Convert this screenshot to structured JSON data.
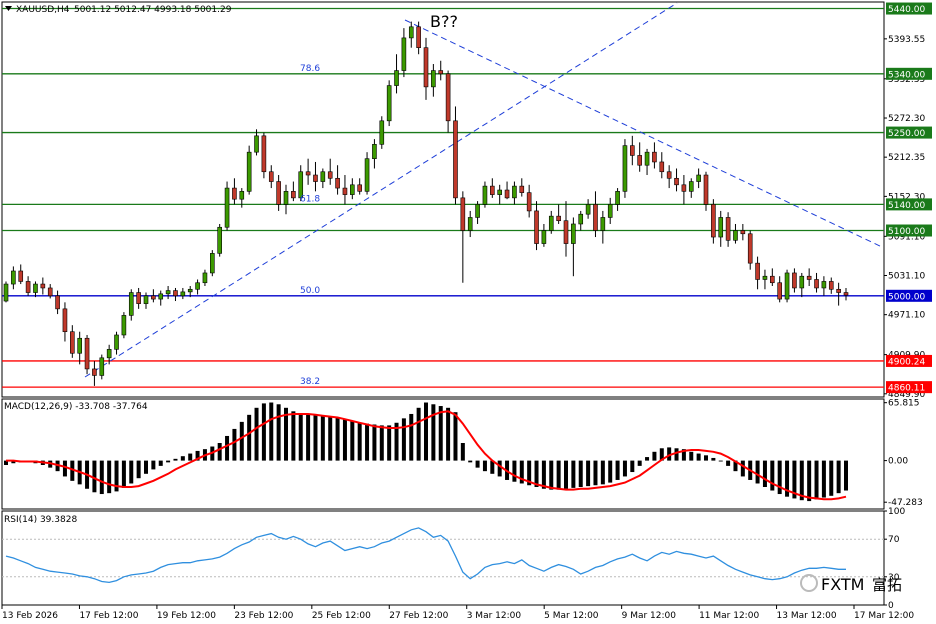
{
  "header": {
    "symbol": "XAUUSD,H4",
    "ohlc": "5001.12 5012.47 4993.18 5001.29"
  },
  "wave_label": "B??",
  "watermark": {
    "logo": "FXTM",
    "text": "富拓"
  },
  "colors": {
    "bull": "#3c9a00",
    "bear": "#c0392b",
    "green_level": "#1a7a1a",
    "red_level": "#ff0000",
    "blue_level": "#0000cc",
    "trend": "#1f3fd8",
    "macd_signal": "#ff0000",
    "rsi": "#2f8fdf"
  },
  "chart_data": [
    {
      "type": "candlestick",
      "title": "XAUUSD,H4",
      "ylim": [
        4845,
        5450
      ],
      "price_ticks": [
        "5393.55",
        "5332.35",
        "5272.30",
        "5212.35",
        "5152.30",
        "5091.10",
        "5031.10",
        "4971.10",
        "4909.90",
        "4849.90"
      ],
      "horizontal_levels": [
        {
          "value": 5440.0,
          "label": "5440.00",
          "color": "green"
        },
        {
          "value": 5340.0,
          "label": "5340.00",
          "color": "green"
        },
        {
          "value": 5250.0,
          "label": "5250.00",
          "color": "green"
        },
        {
          "value": 5140.0,
          "label": "5140.00",
          "color": "green"
        },
        {
          "value": 5100.0,
          "label": "5100.00",
          "color": "green"
        },
        {
          "value": 5000.0,
          "label": "5000.00",
          "color": "blue"
        },
        {
          "value": 4900.24,
          "label": "4900.24",
          "color": "red"
        },
        {
          "value": 4860.11,
          "label": "4860.11",
          "color": "red"
        }
      ],
      "fibonacci_labels": [
        {
          "text": "78.6",
          "value": 5340.0
        },
        {
          "text": "61.8",
          "value": 5140.0
        },
        {
          "text": "50.0",
          "value": 5000.0
        },
        {
          "text": "38.2",
          "value": 4860.11
        }
      ],
      "x_labels": [
        "13 Feb 2026",
        "17 Feb 12:00",
        "19 Feb 12:00",
        "23 Feb 12:00",
        "25 Feb 12:00",
        "27 Feb 12:00",
        "3 Mar 12:00",
        "5 Mar 12:00",
        "9 Mar 12:00",
        "11 Mar 12:00",
        "13 Mar 12:00",
        "17 Mar 12:00"
      ],
      "candles": [
        [
          4992,
          5022,
          4990,
          5018
        ],
        [
          5018,
          5045,
          5010,
          5038
        ],
        [
          5038,
          5048,
          5018,
          5022
        ],
        [
          5022,
          5030,
          5000,
          5005
        ],
        [
          5005,
          5022,
          4998,
          5018
        ],
        [
          5018,
          5028,
          5002,
          5012
        ],
        [
          5012,
          5018,
          4996,
          5000
        ],
        [
          5000,
          5008,
          4972,
          4980
        ],
        [
          4980,
          4990,
          4930,
          4945
        ],
        [
          4945,
          4955,
          4905,
          4912
        ],
        [
          4912,
          4945,
          4895,
          4935
        ],
        [
          4935,
          4940,
          4880,
          4888
        ],
        [
          4888,
          4900,
          4862,
          4878
        ],
        [
          4878,
          4910,
          4872,
          4905
        ],
        [
          4905,
          4925,
          4895,
          4918
        ],
        [
          4918,
          4945,
          4910,
          4940
        ],
        [
          4940,
          4975,
          4935,
          4970
        ],
        [
          4970,
          5010,
          4962,
          5005
        ],
        [
          5005,
          5012,
          4980,
          4988
        ],
        [
          4988,
          5005,
          4980,
          5000
        ],
        [
          5000,
          5010,
          4990,
          4995
        ],
        [
          4995,
          5008,
          4985,
          5003
        ],
        [
          5003,
          5015,
          4995,
          5008
        ],
        [
          5008,
          5012,
          4992,
          5000
        ],
        [
          5000,
          5012,
          4995,
          5006
        ],
        [
          5006,
          5015,
          4998,
          5010
        ],
        [
          5010,
          5025,
          5002,
          5020
        ],
        [
          5020,
          5040,
          5015,
          5035
        ],
        [
          5035,
          5070,
          5030,
          5065
        ],
        [
          5065,
          5110,
          5060,
          5105
        ],
        [
          5105,
          5175,
          5100,
          5165
        ],
        [
          5165,
          5180,
          5140,
          5148
        ],
        [
          5148,
          5165,
          5135,
          5160
        ],
        [
          5160,
          5230,
          5155,
          5220
        ],
        [
          5220,
          5255,
          5215,
          5245
        ],
        [
          5245,
          5250,
          5180,
          5190
        ],
        [
          5190,
          5200,
          5165,
          5175
        ],
        [
          5175,
          5185,
          5130,
          5140
        ],
        [
          5140,
          5170,
          5125,
          5160
        ],
        [
          5160,
          5175,
          5145,
          5150
        ],
        [
          5150,
          5200,
          5145,
          5190
        ],
        [
          5190,
          5210,
          5170,
          5185
        ],
        [
          5185,
          5205,
          5160,
          5175
        ],
        [
          5175,
          5195,
          5165,
          5190
        ],
        [
          5190,
          5210,
          5170,
          5180
        ],
        [
          5180,
          5200,
          5155,
          5165
        ],
        [
          5165,
          5185,
          5140,
          5155
        ],
        [
          5155,
          5180,
          5148,
          5170
        ],
        [
          5170,
          5180,
          5155,
          5160
        ],
        [
          5160,
          5220,
          5155,
          5210
        ],
        [
          5210,
          5240,
          5195,
          5232
        ],
        [
          5232,
          5275,
          5225,
          5268
        ],
        [
          5268,
          5330,
          5260,
          5322
        ],
        [
          5322,
          5370,
          5310,
          5345
        ],
        [
          5345,
          5410,
          5335,
          5395
        ],
        [
          5395,
          5420,
          5380,
          5412
        ],
        [
          5412,
          5420,
          5370,
          5380
        ],
        [
          5380,
          5395,
          5300,
          5320
        ],
        [
          5320,
          5355,
          5305,
          5345
        ],
        [
          5345,
          5360,
          5330,
          5340
        ],
        [
          5340,
          5345,
          5250,
          5268
        ],
        [
          5268,
          5290,
          5140,
          5150
        ],
        [
          5150,
          5160,
          5020,
          5100
        ],
        [
          5100,
          5130,
          5090,
          5120
        ],
        [
          5120,
          5145,
          5110,
          5140
        ],
        [
          5140,
          5175,
          5135,
          5168
        ],
        [
          5168,
          5180,
          5150,
          5155
        ],
        [
          5155,
          5170,
          5140,
          5162
        ],
        [
          5162,
          5175,
          5148,
          5150
        ],
        [
          5150,
          5175,
          5140,
          5168
        ],
        [
          5168,
          5180,
          5152,
          5158
        ],
        [
          5158,
          5170,
          5120,
          5130
        ],
        [
          5130,
          5145,
          5070,
          5080
        ],
        [
          5080,
          5110,
          5075,
          5100
        ],
        [
          5100,
          5130,
          5095,
          5122
        ],
        [
          5122,
          5140,
          5110,
          5115
        ],
        [
          5115,
          5145,
          5060,
          5080
        ],
        [
          5080,
          5120,
          5030,
          5110
        ],
        [
          5110,
          5130,
          5100,
          5125
        ],
        [
          5125,
          5148,
          5118,
          5140
        ],
        [
          5140,
          5160,
          5090,
          5100
        ],
        [
          5100,
          5130,
          5080,
          5120
        ],
        [
          5120,
          5150,
          5110,
          5140
        ],
        [
          5140,
          5165,
          5130,
          5160
        ],
        [
          5160,
          5240,
          5150,
          5230
        ],
        [
          5230,
          5245,
          5200,
          5215
        ],
        [
          5215,
          5235,
          5190,
          5200
        ],
        [
          5200,
          5225,
          5185,
          5220
        ],
        [
          5220,
          5235,
          5195,
          5205
        ],
        [
          5205,
          5220,
          5180,
          5190
        ],
        [
          5190,
          5200,
          5165,
          5180
        ],
        [
          5180,
          5195,
          5160,
          5170
        ],
        [
          5170,
          5185,
          5140,
          5160
        ],
        [
          5160,
          5180,
          5150,
          5175
        ],
        [
          5175,
          5195,
          5165,
          5185
        ],
        [
          5185,
          5190,
          5130,
          5140
        ],
        [
          5140,
          5148,
          5080,
          5090
        ],
        [
          5090,
          5130,
          5075,
          5120
        ],
        [
          5120,
          5128,
          5075,
          5085
        ],
        [
          5085,
          5110,
          5080,
          5100
        ],
        [
          5100,
          5110,
          5085,
          5095
        ],
        [
          5095,
          5100,
          5040,
          5050
        ],
        [
          5050,
          5060,
          5010,
          5025
        ],
        [
          5025,
          5040,
          5010,
          5030
        ],
        [
          5030,
          5042,
          5015,
          5020
        ],
        [
          5020,
          5030,
          4990,
          4995
        ],
        [
          4995,
          5040,
          4990,
          5035
        ],
        [
          5035,
          5042,
          5005,
          5012
        ],
        [
          5012,
          5035,
          4998,
          5030
        ],
        [
          5030,
          5042,
          5015,
          5025
        ],
        [
          5025,
          5035,
          5005,
          5012
        ],
        [
          5012,
          5030,
          5000,
          5022
        ],
        [
          5022,
          5028,
          5003,
          5010
        ],
        [
          5010,
          5020,
          4985,
          5005
        ],
        [
          5005,
          5012,
          4993,
          5001
        ]
      ]
    },
    {
      "type": "bar",
      "title": "MACD(12,26,9) -33.708 -37.764",
      "ylim": [
        -55,
        70
      ],
      "y_ticks": [
        "65.815",
        "0.00",
        "-47.283"
      ],
      "histogram": [
        -5,
        -3,
        -2,
        -2,
        -3,
        -5,
        -8,
        -12,
        -18,
        -23,
        -27,
        -32,
        -36,
        -38,
        -37,
        -35,
        -31,
        -26,
        -20,
        -15,
        -10,
        -6,
        -2,
        2,
        5,
        8,
        11,
        13,
        16,
        20,
        28,
        36,
        44,
        52,
        60,
        65,
        66,
        64,
        60,
        56,
        54,
        53,
        52,
        51,
        50,
        49,
        47,
        45,
        43,
        42,
        41,
        40,
        40,
        43,
        48,
        53,
        60,
        66,
        64,
        62,
        60,
        55,
        20,
        -2,
        -8,
        -12,
        -15,
        -18,
        -22,
        -24,
        -26,
        -28,
        -30,
        -32,
        -33,
        -33,
        -32,
        -31,
        -30,
        -29,
        -28,
        -27,
        -25,
        -22,
        -18,
        -13,
        -6,
        4,
        10,
        14,
        15,
        14,
        13,
        10,
        8,
        6,
        3,
        -1,
        -6,
        -12,
        -18,
        -22,
        -26,
        -30,
        -34,
        -38,
        -41,
        -43,
        -45,
        -46,
        -44,
        -42,
        -40,
        -37,
        -34
      ],
      "signal": [
        0,
        0,
        -1,
        -1,
        -1,
        -2,
        -3,
        -5,
        -7,
        -10,
        -13,
        -16,
        -20,
        -24,
        -27,
        -29,
        -30,
        -30,
        -29,
        -26,
        -23,
        -19,
        -15,
        -10,
        -6,
        -2,
        2,
        6,
        9,
        13,
        17,
        21,
        26,
        31,
        37,
        42,
        47,
        50,
        52,
        53,
        53,
        53,
        52,
        51,
        50,
        49,
        47,
        45,
        43,
        41,
        39,
        38,
        37,
        37,
        38,
        40,
        44,
        48,
        52,
        55,
        56,
        52,
        42,
        30,
        18,
        8,
        0,
        -6,
        -12,
        -17,
        -21,
        -24,
        -27,
        -29,
        -31,
        -32,
        -33,
        -33,
        -32,
        -32,
        -31,
        -30,
        -29,
        -27,
        -25,
        -21,
        -17,
        -11,
        -5,
        1,
        6,
        9,
        11,
        12,
        12,
        11,
        10,
        8,
        4,
        -1,
        -6,
        -11,
        -16,
        -21,
        -26,
        -30,
        -34,
        -37,
        -40,
        -42,
        -43,
        -44,
        -44,
        -43,
        -41
      ]
    },
    {
      "type": "line",
      "title": "RSI(14) 39.3828",
      "ylim": [
        0,
        100
      ],
      "y_ticks": [
        "100",
        "70",
        "30",
        "0"
      ],
      "values": [
        52,
        50,
        47,
        44,
        40,
        38,
        36,
        35,
        34,
        33,
        31,
        30,
        28,
        25,
        24,
        26,
        30,
        32,
        33,
        34,
        36,
        40,
        43,
        44,
        45,
        45,
        47,
        48,
        49,
        51,
        55,
        60,
        64,
        67,
        72,
        74,
        76,
        72,
        70,
        73,
        70,
        65,
        62,
        66,
        68,
        63,
        58,
        60,
        62,
        60,
        62,
        66,
        68,
        72,
        76,
        80,
        82,
        78,
        72,
        74,
        68,
        52,
        35,
        28,
        33,
        40,
        43,
        44,
        46,
        44,
        48,
        42,
        39,
        36,
        40,
        43,
        41,
        38,
        33,
        36,
        40,
        42,
        46,
        49,
        51,
        54,
        50,
        47,
        52,
        56,
        54,
        57,
        55,
        54,
        52,
        50,
        52,
        47,
        42,
        38,
        35,
        32,
        30,
        28,
        27,
        28,
        30,
        34,
        37,
        39,
        39,
        40,
        39,
        38,
        38
      ]
    }
  ]
}
